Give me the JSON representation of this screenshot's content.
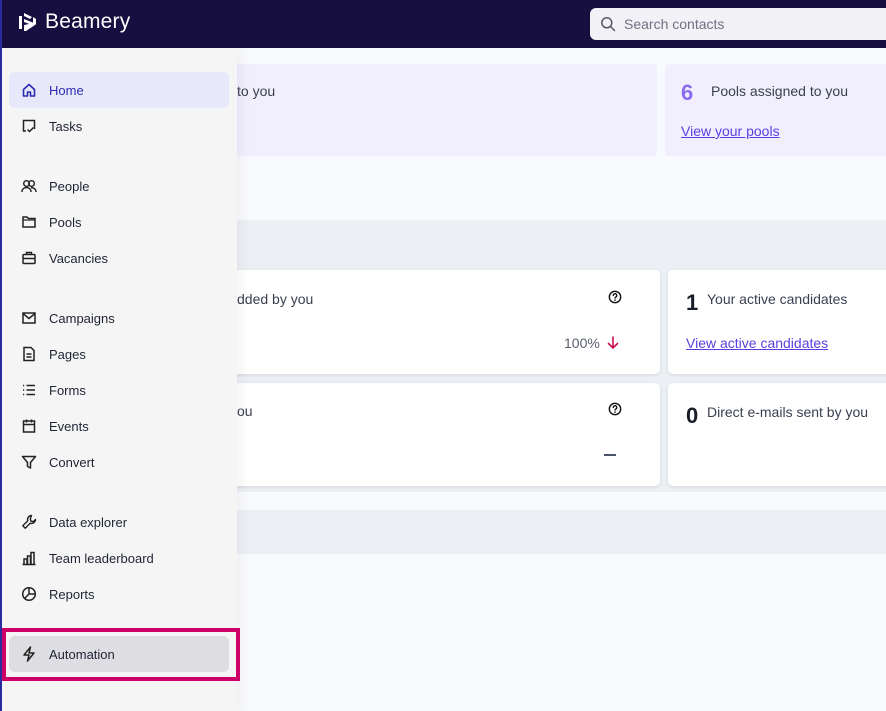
{
  "app": {
    "brand": "Beamery",
    "brand_color": "#160f40",
    "accent_color": "#2d2bb0",
    "highlight_color": "#cc0066"
  },
  "search": {
    "placeholder": "Search contacts",
    "value": "",
    "icon": "search-icon"
  },
  "sidebar": {
    "items": [
      {
        "label": "Home",
        "icon": "home-icon",
        "active": true
      },
      {
        "label": "Tasks",
        "icon": "tasks-icon"
      },
      {
        "label": "People",
        "icon": "people-icon"
      },
      {
        "label": "Pools",
        "icon": "folder-icon"
      },
      {
        "label": "Vacancies",
        "icon": "briefcase-icon"
      },
      {
        "label": "Campaigns",
        "icon": "mail-icon"
      },
      {
        "label": "Pages",
        "icon": "page-icon"
      },
      {
        "label": "Forms",
        "icon": "list-icon"
      },
      {
        "label": "Events",
        "icon": "calendar-icon"
      },
      {
        "label": "Convert",
        "icon": "filter-icon"
      },
      {
        "label": "Data explorer",
        "icon": "wrench-icon"
      },
      {
        "label": "Team leaderboard",
        "icon": "bar-chart-icon"
      },
      {
        "label": "Reports",
        "icon": "pie-chart-icon"
      },
      {
        "label": "Automation",
        "icon": "lightning-icon",
        "highlighted": true
      }
    ]
  },
  "summary": {
    "left_strip_text": "to you",
    "pools": {
      "count": "6",
      "label": "Pools assigned to you",
      "link": "View your pools"
    }
  },
  "cards": {
    "added": {
      "title_partial": "dded by you",
      "change": "100%",
      "trend": "down",
      "trend_color": "#c8104a"
    },
    "second": {
      "title_partial": "ou",
      "change": "—"
    },
    "active_candidates": {
      "count": "1",
      "label": "Your active candidates",
      "link": "View active candidates"
    },
    "direct_emails": {
      "count": "0",
      "label": "Direct e-mails sent by you"
    }
  }
}
